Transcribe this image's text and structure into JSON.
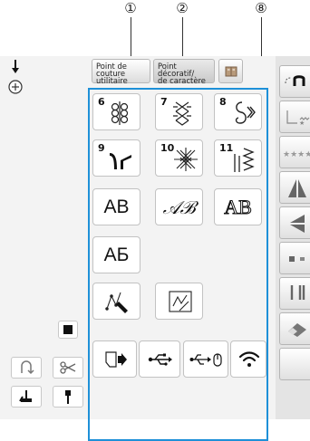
{
  "callouts": {
    "c1": "①",
    "c2": "②",
    "c8": "⑧"
  },
  "tabs": {
    "utility": [
      "Point de",
      "couture",
      "utilitaire"
    ],
    "decorative": [
      "Point",
      "décoratif/",
      "de caractère"
    ]
  },
  "stitch_categories": [
    {
      "number": "6",
      "icon": "ornamental-stitch-icon"
    },
    {
      "number": "7",
      "icon": "cross-stitch-icon"
    },
    {
      "number": "8",
      "icon": "scroll-stitch-icon"
    },
    {
      "number": "9",
      "icon": "satin-stitch-icon"
    },
    {
      "number": "10",
      "icon": "heirloom-stitch-icon"
    },
    {
      "number": "11",
      "icon": "zigzag-stitch-icon"
    }
  ],
  "fonts": {
    "latin_block": "AB",
    "latin_script": "𝒜ℬ",
    "latin_outline": "AB",
    "cyrillic": "АБ"
  },
  "bottom_icons": [
    "file-import-icon",
    "usb-icon",
    "usb-mouse-icon",
    "wifi-icon"
  ],
  "colors": {
    "highlight_border": "#1e90d8"
  }
}
